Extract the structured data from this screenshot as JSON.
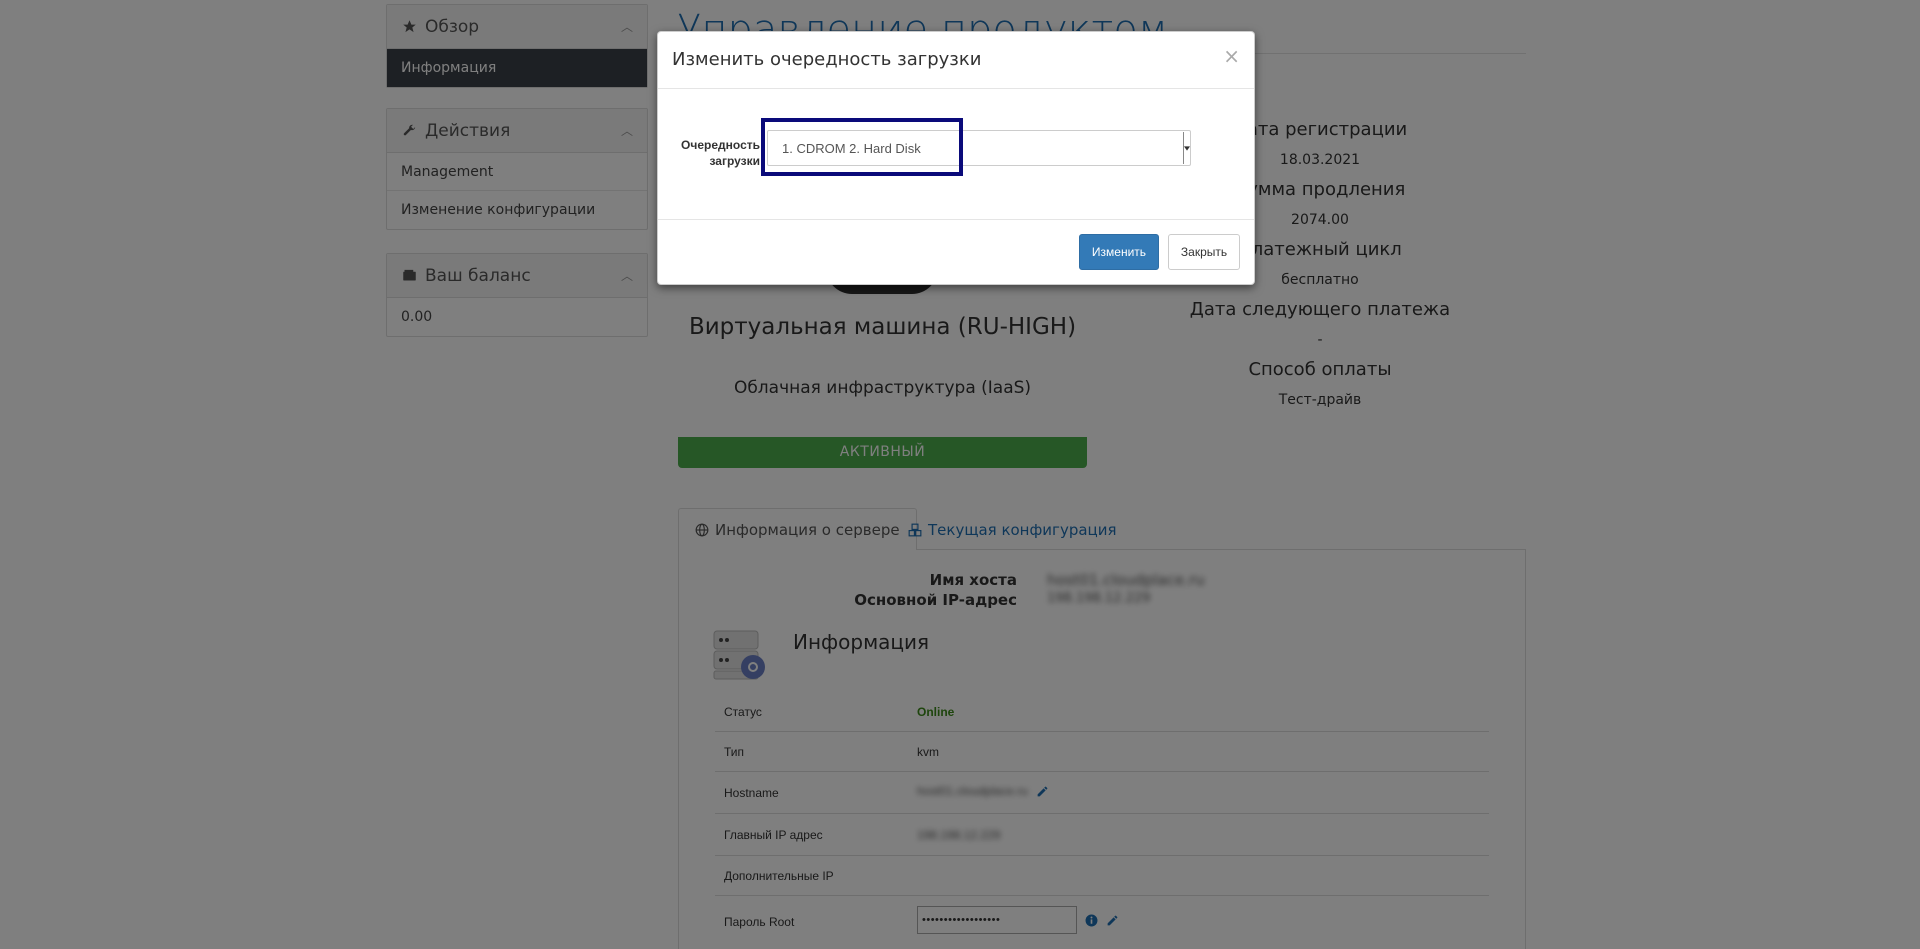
{
  "sidebar": {
    "overview": {
      "title": "Обзор",
      "items": [
        "Информация"
      ]
    },
    "actions": {
      "title": "Действия",
      "items": [
        "Management",
        "Изменение конфигурации"
      ]
    },
    "balance": {
      "title": "Ваш баланс",
      "items": [
        "0.00"
      ]
    }
  },
  "page_title": "Управление продуктом",
  "product": {
    "name": "Виртуальная машина (RU-HIGH)",
    "group": "Облачная инфраструктура (IaaS)",
    "status": "АКТИВНЫЙ"
  },
  "info": [
    {
      "label": "Дата регистрации",
      "value": "18.03.2021"
    },
    {
      "label": "Сумма продления",
      "value": "2074.00"
    },
    {
      "label": "Платежный цикл",
      "value": "бесплатно"
    },
    {
      "label": "Дата следующего платежа",
      "value": "-"
    },
    {
      "label": "Способ оплаты",
      "value": "Тест-драйв"
    }
  ],
  "tabs": [
    "Информация о сервере",
    "Текущая конфигурация"
  ],
  "server": {
    "hostname_label": "Имя хоста",
    "hostname_value": "host01.cloudplace.ru",
    "ip_label": "Основной IP-адрес",
    "ip_value": "198.198.12.229",
    "info_title": "Информация",
    "rows": [
      {
        "key": "Статус",
        "value": "Online"
      },
      {
        "key": "Тип",
        "value": "kvm"
      },
      {
        "key": "Hostname",
        "value": "host01.cloudplace.ru"
      },
      {
        "key": "Главный IP адрес",
        "value": "198.198.12.229"
      },
      {
        "key": "Дополнительные IP",
        "value": ""
      },
      {
        "key": "Пароль Root",
        "value": "••••••••••••••••••"
      }
    ]
  },
  "modal": {
    "title": "Изменить очередность загрузки",
    "close_symbol": "×",
    "field_label_line1": "Очередность",
    "field_label_line2": "загрузки",
    "selected_option": "1. CDROM 2. Hard Disk",
    "submit_label": "Изменить",
    "cancel_label": "Закрыть"
  },
  "colors": {
    "accent": "#337ab7",
    "status_green": "#4cae4c",
    "highlight_border": "#0a0a7a"
  }
}
